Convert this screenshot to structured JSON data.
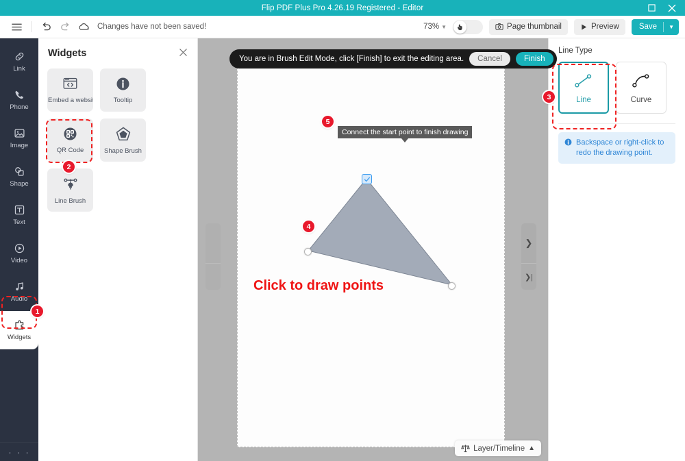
{
  "window": {
    "title": "Flip PDF Plus Pro 4.26.19 Registered - Editor",
    "maximize_icon": "maximize-icon",
    "close_icon": "close-icon"
  },
  "toolbar": {
    "menu_icon": "hamburger-menu-icon",
    "undo_icon": "undo-icon",
    "redo_icon": "redo-icon",
    "cloud_icon": "cloud-alert-icon",
    "save_status": "Changes have not been saved!",
    "zoom_value": "73%",
    "zoom_chevron": "chevron-down-icon",
    "hand_toggle_icon": "hand-pointer-icon",
    "page_thumbnail_label": "Page thumbnail",
    "page_thumbnail_icon": "camera-icon",
    "preview_label": "Preview",
    "preview_icon": "play-icon",
    "save_label": "Save",
    "save_chevron": "chevron-down-icon"
  },
  "rail": {
    "items": [
      {
        "label": "Link",
        "icon": "link-icon"
      },
      {
        "label": "Phone",
        "icon": "phone-icon"
      },
      {
        "label": "Image",
        "icon": "image-icon"
      },
      {
        "label": "Shape",
        "icon": "shape-icon"
      },
      {
        "label": "Text",
        "icon": "text-icon"
      },
      {
        "label": "Video",
        "icon": "video-icon"
      },
      {
        "label": "Audio",
        "icon": "audio-icon"
      },
      {
        "label": "Widgets",
        "icon": "widgets-icon"
      }
    ],
    "more_icon": "ellipsis-icon",
    "badge_1": "1"
  },
  "widgets_panel": {
    "title": "Widgets",
    "close_icon": "close-icon",
    "items": [
      {
        "label": "Embed a website",
        "icon": "browser-code-icon"
      },
      {
        "label": "Tooltip",
        "icon": "info-circle-icon"
      },
      {
        "label": "QR Code",
        "icon": "qr-code-icon"
      },
      {
        "label": "Shape Brush",
        "icon": "pentagon-icon"
      },
      {
        "label": "Line Brush",
        "icon": "pen-node-icon"
      }
    ],
    "badge_2": "2"
  },
  "stage": {
    "banner": {
      "message": "You are in Brush Edit Mode, click [Finish] to exit the editing area.",
      "cancel_label": "Cancel",
      "finish_label": "Finish"
    },
    "drawing": {
      "tooltip": "Connect the start point to finish drawing",
      "hint": "Click to draw points",
      "badge_4": "4",
      "badge_5": "5",
      "fill_color": "#a3abb8",
      "start_node_icon": "check-square-icon"
    },
    "nav": {
      "next_icon": "chevron-right-icon",
      "last_icon": "skip-to-end-icon"
    },
    "layer_timeline": {
      "label": "Layer/Timeline",
      "icon": "layers-icon",
      "collapse_icon": "chevron-up-icon"
    }
  },
  "right_panel": {
    "title": "Line Type",
    "options": [
      {
        "label": "Line",
        "icon": "line-segment-icon",
        "selected": true
      },
      {
        "label": "Curve",
        "icon": "curve-segment-icon",
        "selected": false
      }
    ],
    "badge_3": "3",
    "info_icon": "info-icon",
    "info_text": "Backspace or right-click to redo the drawing point."
  },
  "colors": {
    "accent": "#18b2ba",
    "badge_red": "#e8192c",
    "hint_red": "#ef1414",
    "rail_bg": "#2b3241",
    "stage_bg": "#b4b4b4"
  }
}
